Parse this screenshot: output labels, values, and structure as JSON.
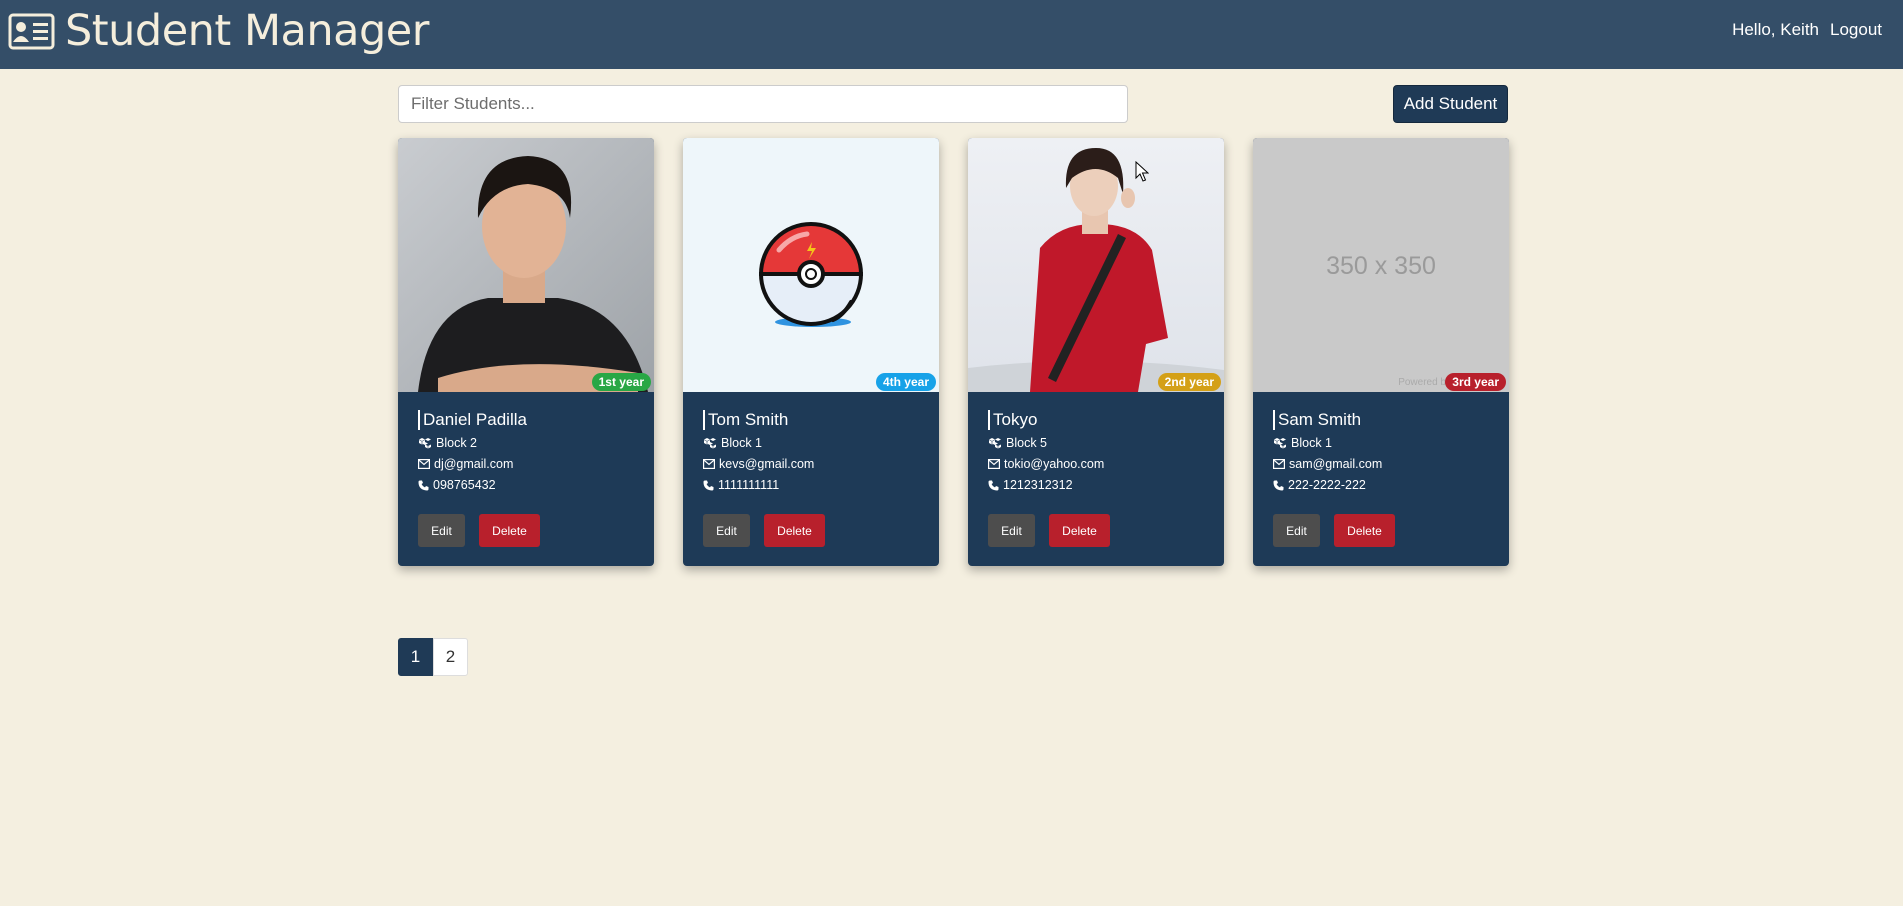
{
  "app": {
    "title": "Student Manager",
    "greeting": "Hello, Keith",
    "logout_label": "Logout"
  },
  "toolbar": {
    "filter_placeholder": "Filter Students...",
    "add_label": "Add Student"
  },
  "students": [
    {
      "name": "Daniel Padilla",
      "block": "Block 2",
      "email": "dj@gmail.com",
      "phone": "098765432",
      "year": "1st year",
      "year_color": "#28a745",
      "image": "photo-man-black-shirt"
    },
    {
      "name": "Tom Smith",
      "block": "Block 1",
      "email": "kevs@gmail.com",
      "phone": "1111111111",
      "year": "4th year",
      "year_color": "#17a2e8",
      "image": "pokeball-illustration"
    },
    {
      "name": "Tokyo",
      "block": "Block 5",
      "email": "tokio@yahoo.com",
      "phone": "1212312312",
      "year": "2nd year",
      "year_color": "#d4a017",
      "image": "photo-woman-red-jumpsuit"
    },
    {
      "name": "Sam Smith",
      "block": "Block 1",
      "email": "sam@gmail.com",
      "phone": "222-2222-222",
      "year": "3rd year",
      "year_color": "#b8202c",
      "image": "placeholder",
      "placeholder_text": "350 x 350",
      "powered_text": "Powered by"
    }
  ],
  "card_actions": {
    "edit_label": "Edit",
    "delete_label": "Delete"
  },
  "pagination": {
    "pages": [
      "1",
      "2"
    ],
    "current": "1"
  },
  "colors": {
    "navbar": "#344e68",
    "background": "#f4efe0",
    "card": "#1e3a57",
    "primary": "#1f3a56",
    "danger": "#b8202c"
  }
}
